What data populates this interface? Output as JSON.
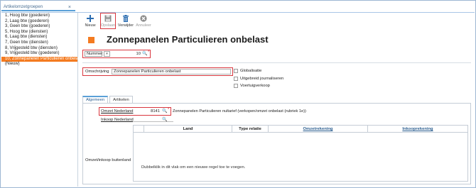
{
  "doc_tab": {
    "title": "Artikelomzetgroepen",
    "close": "×"
  },
  "sidebar": {
    "items": [
      "1, Hoog btw (goederen)",
      "2, Laag btw (goederen)",
      "3, Geen btw (goederen)",
      "5, Hoog btw (diensten)",
      "6, Laag btw (diensten)",
      "7, Geen btw (diensten)",
      "8, Vrijgesteld btw (diensten)",
      "9, Vrijgesteld btw (goederen)",
      "10, Zonnepanelen Particulieren onbelast",
      "(Nieuw)"
    ],
    "selected_index": 8
  },
  "toolbar": {
    "new_label": "Nieuw",
    "save_label": "Opslaan",
    "delete_label": "Verwijder",
    "cancel_label": "Annuleer"
  },
  "header": {
    "title": "Zonnepanelen Particulieren onbelast"
  },
  "number": {
    "label": "Nummer",
    "value": "10"
  },
  "description": {
    "label": "Omschrijving",
    "value": "Zonnepanelen Particulieren onbelast"
  },
  "checks": {
    "globalisatie": "Globalisatie",
    "uitgebreid": "Uitgebreid journaliseren",
    "voertuig": "Voertuigverkoop"
  },
  "tabs": {
    "algemeen": "Algemeen",
    "artikelen": "Artikelen"
  },
  "fields": {
    "omzet_label": "Omzet Nederland",
    "omzet_value": "8141",
    "omzet_desc": "Zonnepanelen Particulieren nultarief (verkopen/omzet onbelast (rubriek 1e))",
    "inkoop_label": "Inkoop Nederland",
    "buitenland_label": "Omzet/inkoop buitenland"
  },
  "grid": {
    "columns": [
      "Land",
      "Type relatie",
      "Omzetrekening",
      "Inkooprekening"
    ],
    "hint": "Dubbelklik in dit vlak om een nieuwe regel toe te voegen."
  },
  "colors": {
    "accent": "#f47b20",
    "highlight": "#d9363e",
    "link": "#2a5d8f"
  }
}
